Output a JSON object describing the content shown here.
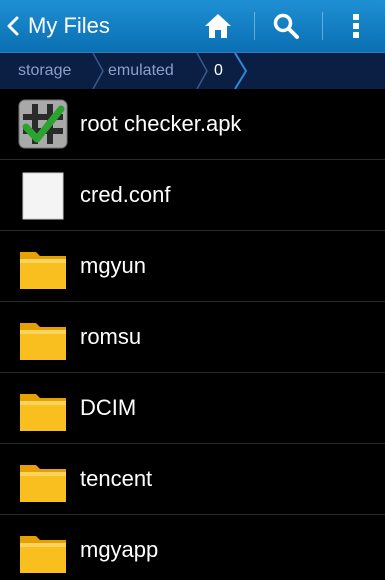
{
  "header": {
    "title": "My Files",
    "accent": "#1a86cc"
  },
  "breadcrumb": [
    "storage",
    "emulated",
    "0"
  ],
  "files": [
    {
      "name": "root checker.apk",
      "icon": "apk-icon"
    },
    {
      "name": "cred.conf",
      "icon": "file-icon"
    },
    {
      "name": "mgyun",
      "icon": "folder-icon"
    },
    {
      "name": "romsu",
      "icon": "folder-icon"
    },
    {
      "name": "DCIM",
      "icon": "folder-icon"
    },
    {
      "name": "tencent",
      "icon": "folder-icon"
    },
    {
      "name": "mgyapp",
      "icon": "folder-icon"
    }
  ]
}
